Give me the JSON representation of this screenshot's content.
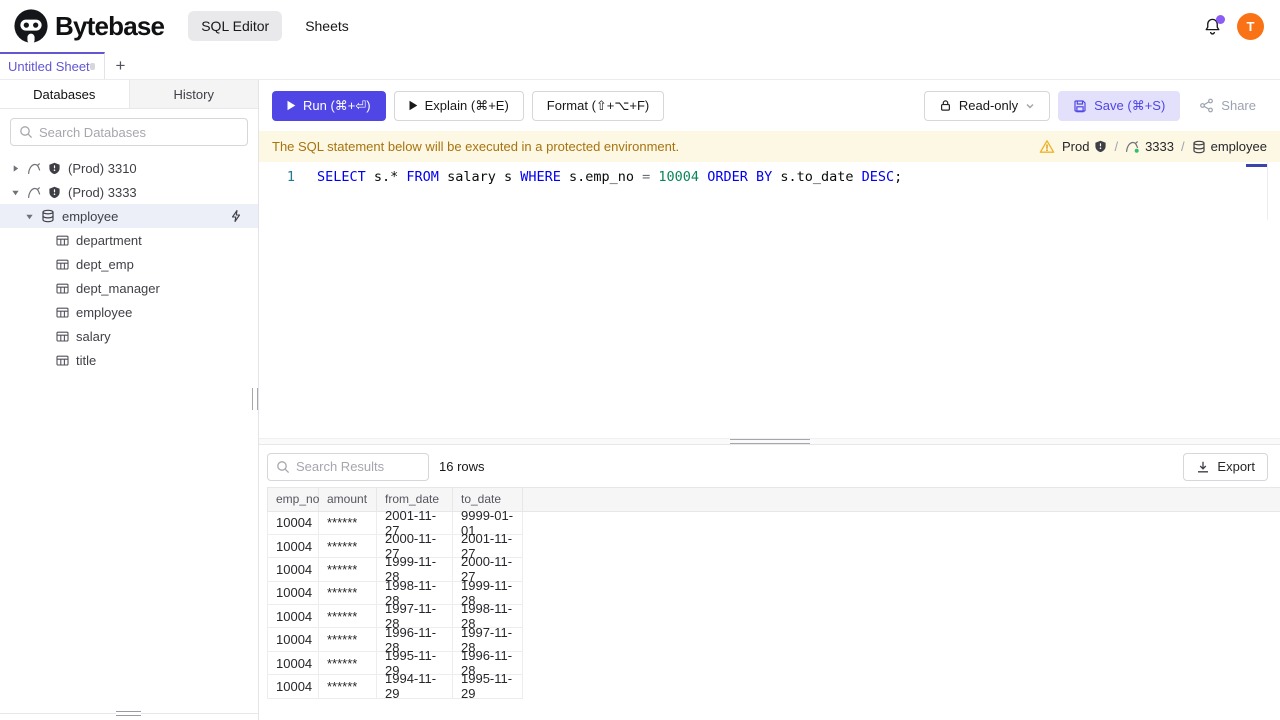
{
  "header": {
    "brand": "Bytebase",
    "nav": [
      {
        "label": "SQL Editor",
        "active": true
      },
      {
        "label": "Sheets",
        "active": false
      }
    ],
    "avatar_letter": "T"
  },
  "tabbar": {
    "active_tab": "Untitled Sheet",
    "new_tab": "+"
  },
  "sidebar": {
    "tabs": [
      {
        "label": "Databases",
        "active": true
      },
      {
        "label": "History",
        "active": false
      }
    ],
    "search_placeholder": "Search Databases",
    "tree": [
      {
        "kind": "instance",
        "label": "(Prod) 3310",
        "expanded": false
      },
      {
        "kind": "instance",
        "label": "(Prod) 3333",
        "expanded": true
      },
      {
        "kind": "database",
        "label": "employee",
        "expanded": true,
        "selected": true
      },
      {
        "kind": "table",
        "label": "department"
      },
      {
        "kind": "table",
        "label": "dept_emp"
      },
      {
        "kind": "table",
        "label": "dept_manager"
      },
      {
        "kind": "table",
        "label": "employee"
      },
      {
        "kind": "table",
        "label": "salary"
      },
      {
        "kind": "table",
        "label": "title"
      }
    ]
  },
  "toolbar": {
    "run": "Run (⌘+⏎)",
    "explain": "Explain (⌘+E)",
    "format": "Format (⇧+⌥+F)",
    "readonly": "Read-only",
    "save": "Save (⌘+S)",
    "share": "Share"
  },
  "banner": {
    "message": "The SQL statement below will be executed in a protected environment.",
    "environment": "Prod",
    "separator": "/",
    "instance": "3333",
    "database": "employee"
  },
  "editor": {
    "line_number": "1",
    "sql": "SELECT s.* FROM salary s WHERE s.emp_no = 10004 ORDER BY s.to_date DESC;",
    "tokens": [
      {
        "text": "SELECT",
        "type": "keyword"
      },
      {
        "text": " s.* ",
        "type": "plain"
      },
      {
        "text": "FROM",
        "type": "keyword"
      },
      {
        "text": " salary s ",
        "type": "plain"
      },
      {
        "text": "WHERE",
        "type": "keyword"
      },
      {
        "text": " s.emp_no ",
        "type": "plain"
      },
      {
        "text": "=",
        "type": "operator"
      },
      {
        "text": " ",
        "type": "plain"
      },
      {
        "text": "10004",
        "type": "number"
      },
      {
        "text": " ",
        "type": "plain"
      },
      {
        "text": "ORDER",
        "type": "keyword"
      },
      {
        "text": " ",
        "type": "plain"
      },
      {
        "text": "BY",
        "type": "keyword"
      },
      {
        "text": " s.to_date ",
        "type": "plain"
      },
      {
        "text": "DESC",
        "type": "keyword"
      },
      {
        "text": ";",
        "type": "plain"
      }
    ]
  },
  "results": {
    "search_placeholder": "Search Results",
    "count": "16 rows",
    "export": "Export",
    "columns": [
      "emp_no",
      "amount",
      "from_date",
      "to_date"
    ],
    "rows": [
      [
        "10004",
        "******",
        "2001-11-27",
        "9999-01-01"
      ],
      [
        "10004",
        "******",
        "2000-11-27",
        "2001-11-27"
      ],
      [
        "10004",
        "******",
        "1999-11-28",
        "2000-11-27"
      ],
      [
        "10004",
        "******",
        "1998-11-28",
        "1999-11-28"
      ],
      [
        "10004",
        "******",
        "1997-11-28",
        "1998-11-28"
      ],
      [
        "10004",
        "******",
        "1996-11-28",
        "1997-11-28"
      ],
      [
        "10004",
        "******",
        "1995-11-29",
        "1996-11-28"
      ],
      [
        "10004",
        "******",
        "1994-11-29",
        "1995-11-29"
      ]
    ]
  },
  "colors": {
    "accent": "#4f46e5",
    "active_tab": "#6356d2",
    "avatar_bg": "#f97316",
    "notification_dot": "#8b5cf6",
    "banner_bg": "#fcf8e4",
    "banner_text": "#a8730f",
    "syntax_keyword": "#0000f0",
    "syntax_number": "#098658",
    "warning_icon": "#f0b429",
    "mysql_status_dot": "#2fbf71",
    "selected_tree_bg": "#edeff8"
  }
}
